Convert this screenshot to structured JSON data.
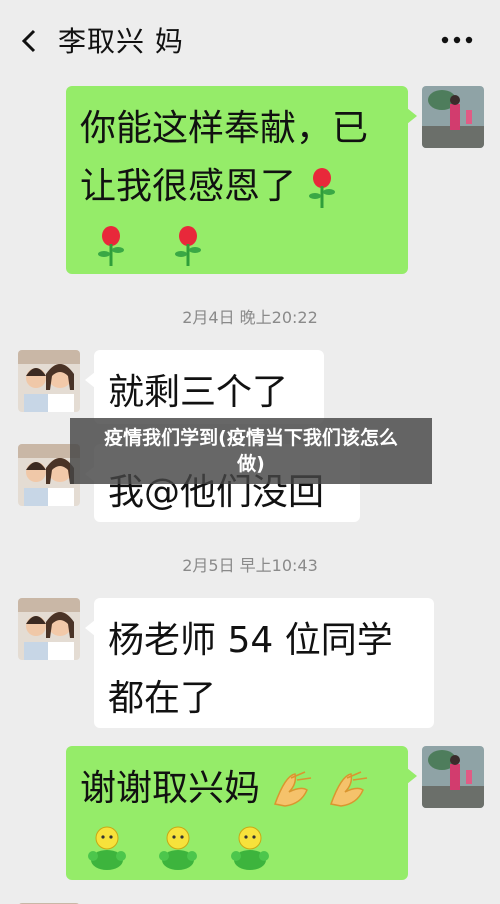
{
  "header": {
    "title": "李取兴 妈",
    "back_icon": "chevron-left-icon",
    "more_icon": "more-dots-icon"
  },
  "messages": [
    {
      "side": "right",
      "lines": [
        "你能这样奉献，已",
        "让我很感恩了"
      ],
      "emoji": [
        "rose-emoji",
        "rose-emoji",
        "rose-emoji"
      ]
    },
    {
      "side": "left",
      "text": "就剩三个了"
    },
    {
      "side": "left",
      "text": "我@他们没回"
    },
    {
      "side": "left",
      "lines": [
        "杨老师 54 位同学",
        "都在了"
      ]
    },
    {
      "side": "right",
      "text": "谢谢取兴妈",
      "emoji": [
        "clap-emoji",
        "clap-emoji",
        "thumbs-up-figure-emoji",
        "thumbs-up-figure-emoji",
        "thumbs-up-figure-emoji"
      ]
    }
  ],
  "timestamps": {
    "t1": "2月4日 晚上20:22",
    "t2": "2月5日 早上10:43"
  },
  "overlay": {
    "line1": "疫情我们学到(疫情当下我们该怎么",
    "line2": "做)"
  },
  "colors": {
    "background": "#ededed",
    "green_bubble": "#95ec69",
    "white_bubble": "#ffffff"
  }
}
